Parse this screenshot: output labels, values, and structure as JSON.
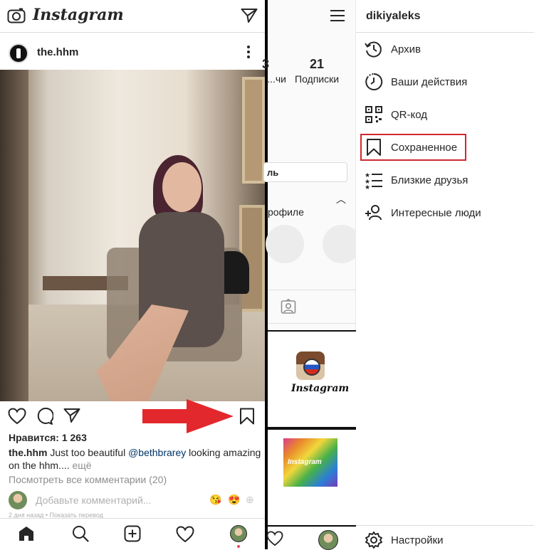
{
  "left_panel": {
    "app_name": "Instagram",
    "post": {
      "username": "the.hhm",
      "likes": "Нравится: 1 263",
      "caption_user": "the.hhm",
      "caption_text_1": " Just too beautiful ",
      "caption_mention": "@bethbrarey",
      "caption_text_2": " looking amazing on the hhm....",
      "caption_more": " ещё",
      "view_comments": "Посмотреть все комментарии (20)",
      "comment_placeholder": "Добавьте комментарий...",
      "reactions": [
        "😘",
        "😍",
        "⊕"
      ],
      "footer_small": "2 дня назад • Показать перевод"
    },
    "icons": {
      "camera": "camera-icon",
      "direct": "direct-message-icon",
      "like": "heart-icon",
      "comment": "comment-icon",
      "share": "share-icon",
      "save": "bookmark-icon",
      "home": "home-icon",
      "search": "search-icon",
      "add": "add-post-icon",
      "activity": "heart-icon"
    },
    "annotation_color": "#e3282d"
  },
  "middle_panel": {
    "following_count": "21",
    "following_label": "Подписки",
    "followers_label_clipped": "чи...",
    "count_clipped": "3",
    "edit_button_clipped": "ль",
    "profile_text_clipped": "рофиле"
  },
  "right_panel": {
    "username": "dikiyaleks",
    "menu": [
      {
        "label": "Архив",
        "icon": "archive-icon"
      },
      {
        "label": "Ваши действия",
        "icon": "activity-clock-icon"
      },
      {
        "label": "QR-код",
        "icon": "qr-code-icon"
      },
      {
        "label": "Сохраненное",
        "icon": "bookmark-icon",
        "highlighted": true
      },
      {
        "label": "Близкие друзья",
        "icon": "close-friends-icon"
      },
      {
        "label": "Интересные люди",
        "icon": "add-person-icon"
      }
    ],
    "settings_label": "Настройки",
    "highlight_color": "#d0282e"
  }
}
